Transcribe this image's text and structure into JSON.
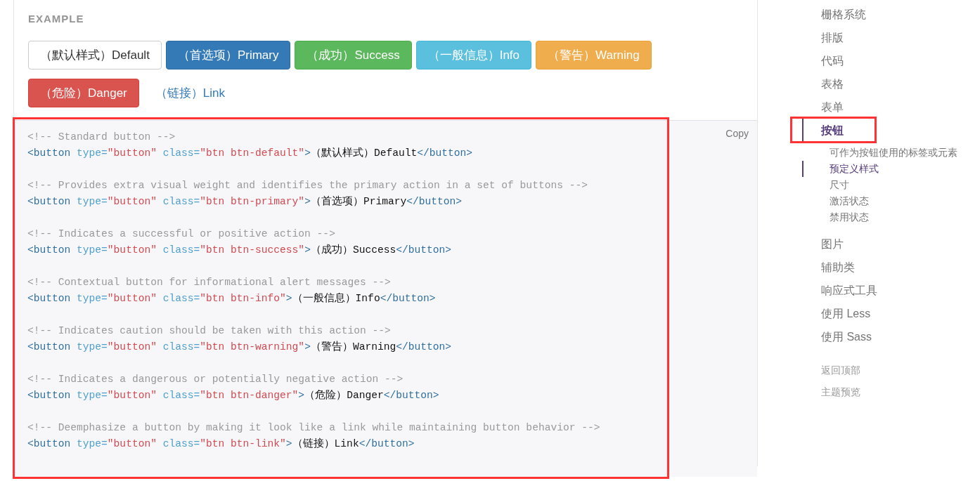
{
  "example": {
    "title": "EXAMPLE",
    "buttons": [
      {
        "label": "（默认样式）Default",
        "kind": "default"
      },
      {
        "label": "（首选项）Primary",
        "kind": "primary"
      },
      {
        "label": "（成功）Success",
        "kind": "success"
      },
      {
        "label": "（一般信息）Info",
        "kind": "info"
      },
      {
        "label": "（警告）Warning",
        "kind": "warning"
      },
      {
        "label": "（危险）Danger",
        "kind": "danger"
      },
      {
        "label": "（链接）Link",
        "kind": "link"
      }
    ]
  },
  "code": {
    "copy_label": "Copy",
    "highlighted": true,
    "snippets": [
      {
        "comment": "<!-- Standard button -->",
        "tokens": [
          {
            "kind": "tag",
            "text": "<button"
          },
          {
            "kind": "attr",
            "text": " type="
          },
          {
            "kind": "string",
            "text": "\"button\""
          },
          {
            "kind": "attr",
            "text": " class="
          },
          {
            "kind": "string",
            "text": "\"btn btn-default\""
          },
          {
            "kind": "tag",
            "text": ">"
          },
          {
            "kind": "text",
            "text": "（默认样式）Default"
          },
          {
            "kind": "tag",
            "text": "</button>"
          }
        ]
      },
      {
        "comment": "<!-- Provides extra visual weight and identifies the primary action in a set of buttons -->",
        "tokens": [
          {
            "kind": "tag",
            "text": "<button"
          },
          {
            "kind": "attr",
            "text": " type="
          },
          {
            "kind": "string",
            "text": "\"button\""
          },
          {
            "kind": "attr",
            "text": " class="
          },
          {
            "kind": "string",
            "text": "\"btn btn-primary\""
          },
          {
            "kind": "tag",
            "text": ">"
          },
          {
            "kind": "text",
            "text": "（首选项）Primary"
          },
          {
            "kind": "tag",
            "text": "</button>"
          }
        ]
      },
      {
        "comment": "<!-- Indicates a successful or positive action -->",
        "tokens": [
          {
            "kind": "tag",
            "text": "<button"
          },
          {
            "kind": "attr",
            "text": " type="
          },
          {
            "kind": "string",
            "text": "\"button\""
          },
          {
            "kind": "attr",
            "text": " class="
          },
          {
            "kind": "string",
            "text": "\"btn btn-success\""
          },
          {
            "kind": "tag",
            "text": ">"
          },
          {
            "kind": "text",
            "text": "（成功）Success"
          },
          {
            "kind": "tag",
            "text": "</button>"
          }
        ]
      },
      {
        "comment": "<!-- Contextual button for informational alert messages -->",
        "tokens": [
          {
            "kind": "tag",
            "text": "<button"
          },
          {
            "kind": "attr",
            "text": " type="
          },
          {
            "kind": "string",
            "text": "\"button\""
          },
          {
            "kind": "attr",
            "text": " class="
          },
          {
            "kind": "string",
            "text": "\"btn btn-info\""
          },
          {
            "kind": "tag",
            "text": ">"
          },
          {
            "kind": "text",
            "text": "（一般信息）Info"
          },
          {
            "kind": "tag",
            "text": "</button>"
          }
        ]
      },
      {
        "comment": "<!-- Indicates caution should be taken with this action -->",
        "tokens": [
          {
            "kind": "tag",
            "text": "<button"
          },
          {
            "kind": "attr",
            "text": " type="
          },
          {
            "kind": "string",
            "text": "\"button\""
          },
          {
            "kind": "attr",
            "text": " class="
          },
          {
            "kind": "string",
            "text": "\"btn btn-warning\""
          },
          {
            "kind": "tag",
            "text": ">"
          },
          {
            "kind": "text",
            "text": "（警告）Warning"
          },
          {
            "kind": "tag",
            "text": "</button>"
          }
        ]
      },
      {
        "comment": "<!-- Indicates a dangerous or potentially negative action -->",
        "tokens": [
          {
            "kind": "tag",
            "text": "<button"
          },
          {
            "kind": "attr",
            "text": " type="
          },
          {
            "kind": "string",
            "text": "\"button\""
          },
          {
            "kind": "attr",
            "text": " class="
          },
          {
            "kind": "string",
            "text": "\"btn btn-danger\""
          },
          {
            "kind": "tag",
            "text": ">"
          },
          {
            "kind": "text",
            "text": "（危险）Danger"
          },
          {
            "kind": "tag",
            "text": "</button>"
          }
        ]
      },
      {
        "comment": "<!-- Deemphasize a button by making it look like a link while maintaining button behavior -->",
        "tokens": [
          {
            "kind": "tag",
            "text": "<button"
          },
          {
            "kind": "attr",
            "text": " type="
          },
          {
            "kind": "string",
            "text": "\"button\""
          },
          {
            "kind": "attr",
            "text": " class="
          },
          {
            "kind": "string",
            "text": "\"btn btn-link\""
          },
          {
            "kind": "tag",
            "text": ">"
          },
          {
            "kind": "text",
            "text": "（链接）Link"
          },
          {
            "kind": "tag",
            "text": "</button>"
          }
        ]
      }
    ]
  },
  "sidebar": {
    "items": [
      {
        "label": "栅格系统",
        "selected": false,
        "highlighted": false
      },
      {
        "label": "排版",
        "selected": false,
        "highlighted": false
      },
      {
        "label": "代码",
        "selected": false,
        "highlighted": false
      },
      {
        "label": "表格",
        "selected": false,
        "highlighted": false
      },
      {
        "label": "表单",
        "selected": false,
        "highlighted": false
      },
      {
        "label": "按钮",
        "selected": true,
        "highlighted": true,
        "children": [
          {
            "label": "可作为按钮使用的标签或元素",
            "selected": false
          },
          {
            "label": "预定义样式",
            "selected": true
          },
          {
            "label": "尺寸",
            "selected": false
          },
          {
            "label": "激活状态",
            "selected": false
          },
          {
            "label": "禁用状态",
            "selected": false
          }
        ]
      },
      {
        "label": "图片",
        "selected": false,
        "highlighted": false
      },
      {
        "label": "辅助类",
        "selected": false,
        "highlighted": false
      },
      {
        "label": "响应式工具",
        "selected": false,
        "highlighted": false
      },
      {
        "label": "使用 Less",
        "selected": false,
        "highlighted": false
      },
      {
        "label": "使用 Sass",
        "selected": false,
        "highlighted": false
      }
    ],
    "footer_links": [
      "返回顶部",
      "主题预览"
    ]
  }
}
